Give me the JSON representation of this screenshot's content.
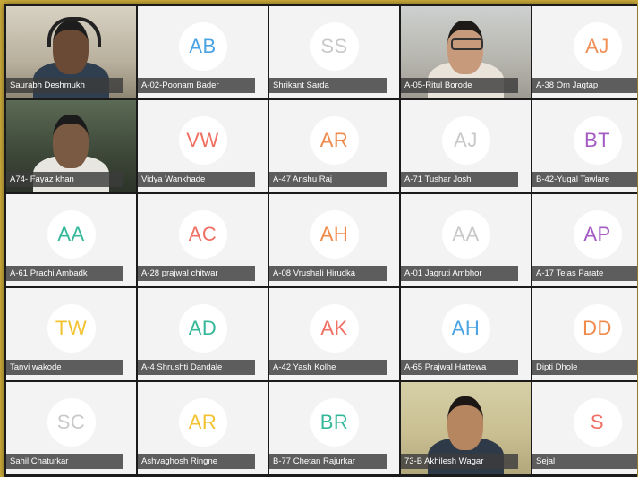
{
  "participants": [
    {
      "name": "Saurabh Deshmukh",
      "initials": "",
      "color": "",
      "video": "headset-man"
    },
    {
      "name": "A-02-Poonam Bader",
      "initials": "AB",
      "color": "#4aa3e3",
      "video": ""
    },
    {
      "name": "Shrikant Sarda",
      "initials": "SS",
      "color": "#c9c9c9",
      "video": ""
    },
    {
      "name": "A-05-Ritul Borode",
      "initials": "",
      "color": "",
      "video": "glasses-girl"
    },
    {
      "name": "A-38 Om Jagtap",
      "initials": "AJ",
      "color": "#f0915a",
      "video": ""
    },
    {
      "name": "A74- Fayaz khan",
      "initials": "",
      "color": "",
      "video": "man-room"
    },
    {
      "name": "Vidya Wankhade",
      "initials": "VW",
      "color": "#f06f63",
      "video": ""
    },
    {
      "name": "A-47 Anshu Raj",
      "initials": "AR",
      "color": "#f08a4b",
      "video": ""
    },
    {
      "name": "A-71 Tushar Joshi",
      "initials": "AJ",
      "color": "#c9c9c9",
      "video": ""
    },
    {
      "name": "B-42-Yugal Tawlare",
      "initials": "BT",
      "color": "#a45bc4",
      "video": ""
    },
    {
      "name": "A-61 Prachi Ambadk",
      "initials": "AA",
      "color": "#35b89a",
      "video": ""
    },
    {
      "name": "A-28 prajwal chitwar",
      "initials": "AC",
      "color": "#f06f63",
      "video": ""
    },
    {
      "name": "A-08 Vrushali Hirudka",
      "initials": "AH",
      "color": "#f08a4b",
      "video": ""
    },
    {
      "name": "A-01 Jagruti Ambhor",
      "initials": "AA",
      "color": "#c9c9c9",
      "video": ""
    },
    {
      "name": "A-17 Tejas Parate",
      "initials": "AP",
      "color": "#a45bc4",
      "video": ""
    },
    {
      "name": "Tanvi wakode",
      "initials": "TW",
      "color": "#f2c230",
      "video": ""
    },
    {
      "name": "A-4 Shrushti Dandale",
      "initials": "AD",
      "color": "#35b89a",
      "video": ""
    },
    {
      "name": "A-42 Yash Kolhe",
      "initials": "AK",
      "color": "#f06f63",
      "video": ""
    },
    {
      "name": "A-65 Prajwal Hattewa",
      "initials": "AH",
      "color": "#4aa3e3",
      "video": ""
    },
    {
      "name": "Dipti Dhole",
      "initials": "DD",
      "color": "#f08a4b",
      "video": ""
    },
    {
      "name": "Sahil Chaturkar",
      "initials": "SC",
      "color": "#c9c9c9",
      "video": ""
    },
    {
      "name": "Ashvaghosh Ringne",
      "initials": "AR",
      "color": "#f2c230",
      "video": ""
    },
    {
      "name": "B-77 Chetan Rajurkar",
      "initials": "BR",
      "color": "#35b89a",
      "video": ""
    },
    {
      "name": "73-B Akhilesh Wagar",
      "initials": "",
      "color": "",
      "video": "boy"
    },
    {
      "name": "Sejal",
      "initials": "S",
      "color": "#f06f63",
      "video": ""
    }
  ]
}
